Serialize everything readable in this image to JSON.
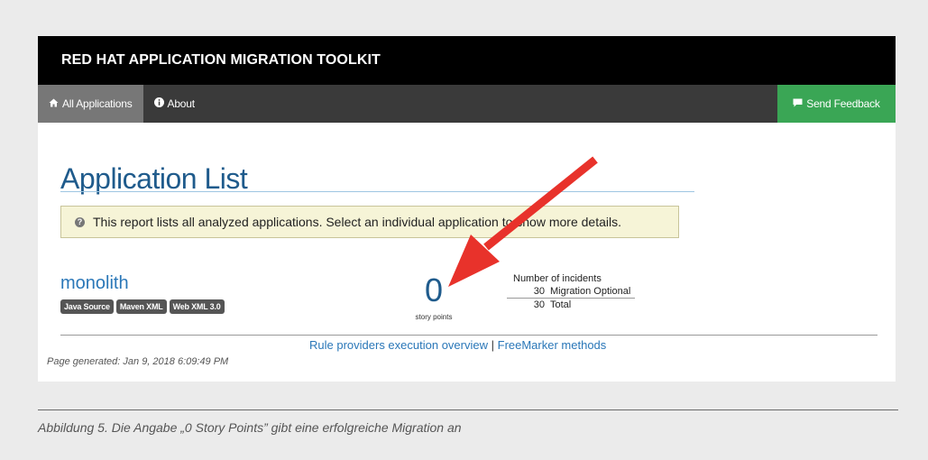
{
  "header": {
    "brand": "RED HAT APPLICATION MIGRATION TOOLKIT"
  },
  "nav": {
    "items": [
      {
        "label": "All Applications",
        "icon": "home-icon",
        "active": true
      },
      {
        "label": "About",
        "icon": "info-icon",
        "active": false
      }
    ],
    "feedback": {
      "label": "Send Feedback",
      "icon": "comment-icon"
    }
  },
  "main": {
    "title": "Application List",
    "info": "This report lists all analyzed applications. Select an individual application to show more details.",
    "application": {
      "name": "monolith",
      "tags": [
        "Java Source",
        "Maven XML",
        "Web XML 3.0"
      ],
      "story_points": "0",
      "story_points_label": "story points",
      "incidents_header": "Number of incidents",
      "incidents": [
        {
          "count": "30",
          "label": "Migration Optional"
        }
      ],
      "total": {
        "count": "30",
        "label": "Total"
      }
    },
    "footer_links": [
      "Rule providers execution overview",
      "FreeMarker methods"
    ],
    "footer_separator": "|",
    "generated": "Page generated: Jan 9, 2018 6:09:49 PM"
  },
  "annotation": {
    "arrow_color": "#e8322b"
  },
  "caption": "Abbildung 5. Die Angabe „0 Story Points” gibt eine erfolgreiche Migration an",
  "colors": {
    "nav_active": "#777777",
    "feedback": "#3aa655",
    "link": "#2a77b8",
    "title": "#1f5b8c"
  }
}
